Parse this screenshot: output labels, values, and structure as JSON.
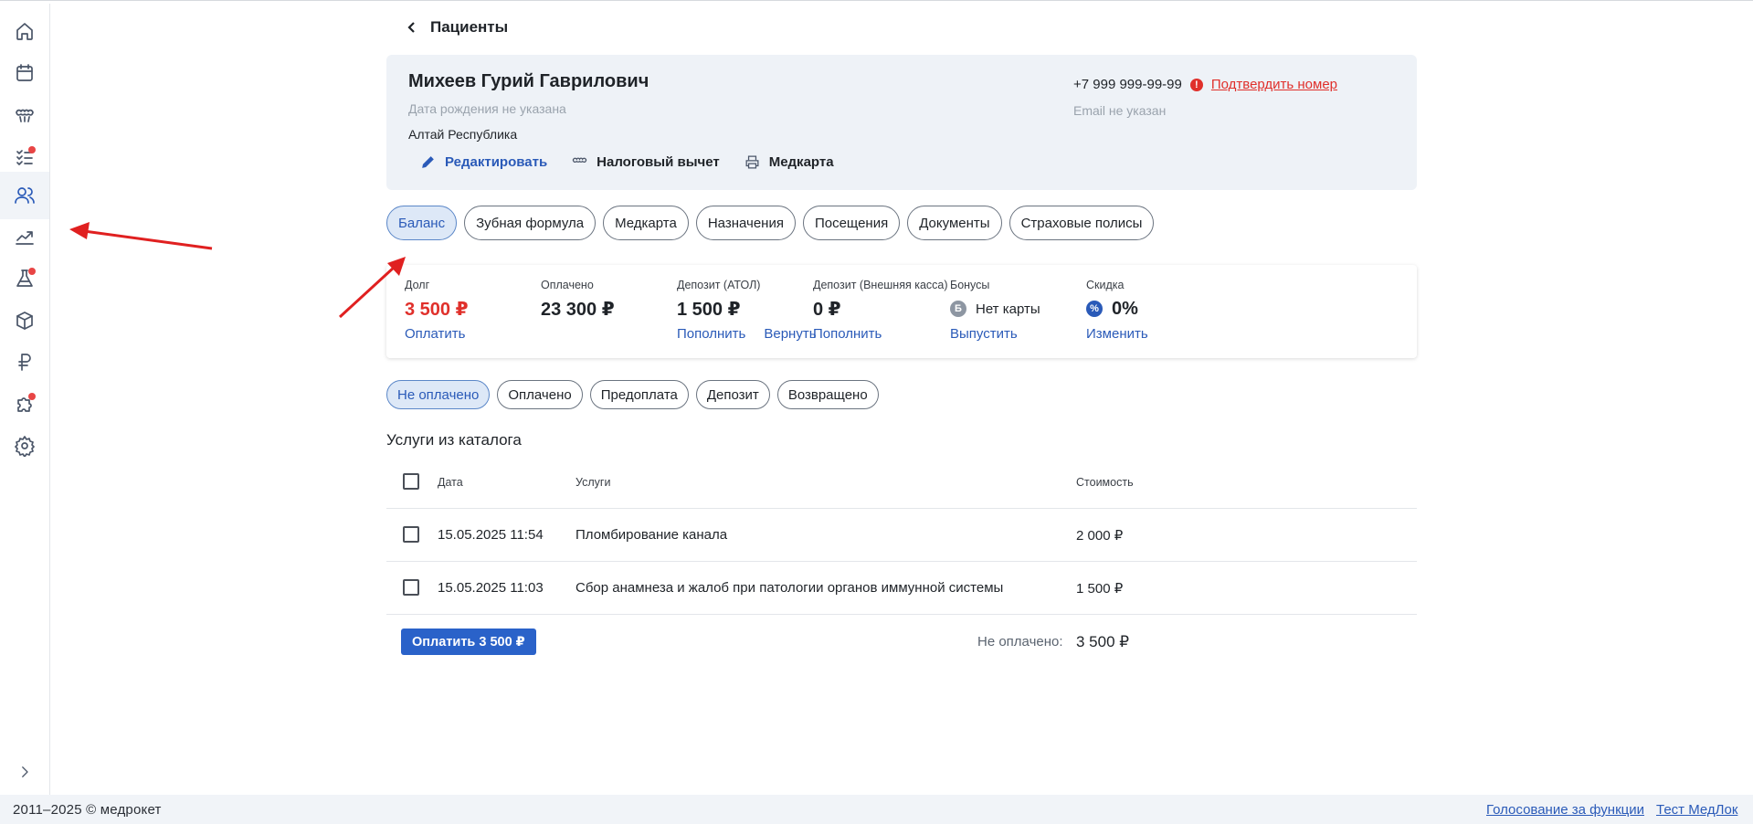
{
  "sidebar": {
    "items": [
      {
        "icon": "home-icon"
      },
      {
        "icon": "calendar-icon"
      },
      {
        "icon": "teeth-icon"
      },
      {
        "icon": "tasks-icon",
        "badge": true
      },
      {
        "icon": "patients-icon",
        "active": true
      },
      {
        "icon": "analytics-icon"
      },
      {
        "icon": "lab-flask-icon",
        "badge": true
      },
      {
        "icon": "box-icon"
      },
      {
        "icon": "ruble-icon"
      },
      {
        "icon": "puzzle-icon",
        "badge": true
      },
      {
        "icon": "gear-icon"
      }
    ],
    "expand_icon": "chevron-right-icon"
  },
  "header": {
    "back_label": "Пациенты"
  },
  "patient": {
    "name": "Михеев Гурий Гаврилович",
    "birth": "Дата рождения не указана",
    "region": "Алтай Республика",
    "phone": "+7 999 999-99-99",
    "confirm_label": "Подтвердить номер",
    "email": "Email не указан",
    "actions": {
      "edit": "Редактировать",
      "tax": "Налоговый вычет",
      "card": "Медкарта"
    }
  },
  "tabs": [
    "Баланс",
    "Зубная формула",
    "Медкарта",
    "Назначения",
    "Посещения",
    "Документы",
    "Страховые полисы"
  ],
  "active_tab": "Баланс",
  "balance": {
    "debt": {
      "label": "Долг",
      "value": "3 500 ₽",
      "link": "Оплатить"
    },
    "paid": {
      "label": "Оплачено",
      "value": "23 300 ₽"
    },
    "deposit_atol": {
      "label": "Депозит (АТОЛ)",
      "value": "1 500 ₽",
      "link1": "Пополнить",
      "link2": "Вернуть"
    },
    "deposit_ext": {
      "label": "Депозит (Внешняя касса)",
      "value": "0 ₽",
      "link": "Пополнить"
    },
    "bonuses": {
      "label": "Бонусы",
      "badge": "Б",
      "value": "Нет карты",
      "link": "Выпустить"
    },
    "discount": {
      "label": "Скидка",
      "badge": "%",
      "value": "0%",
      "link": "Изменить"
    }
  },
  "filters": [
    "Не оплачено",
    "Оплачено",
    "Предоплата",
    "Депозит",
    "Возвращено"
  ],
  "active_filter": "Не оплачено",
  "services": {
    "title": "Услуги из каталога",
    "columns": {
      "date": "Дата",
      "service": "Услуги",
      "cost": "Стоимость"
    },
    "rows": [
      {
        "date": "15.05.2025 11:54",
        "service": "Пломбирование канала",
        "cost": "2 000 ₽"
      },
      {
        "date": "15.05.2025 11:03",
        "service": "Сбор анамнеза и жалоб при патологии органов иммунной системы",
        "cost": "1 500 ₽"
      }
    ],
    "pay_button": "Оплатить 3 500 ₽",
    "unpaid_label": "Не оплачено:",
    "unpaid_value": "3 500 ₽"
  },
  "footer": {
    "copyright": "2011–2025 © медрокет",
    "links": [
      "Голосование за функции",
      "Тест МедЛок"
    ]
  },
  "colors": {
    "accent": "#2a5ab8",
    "danger": "#e0302b",
    "annotation_arrow": "#e02020"
  }
}
